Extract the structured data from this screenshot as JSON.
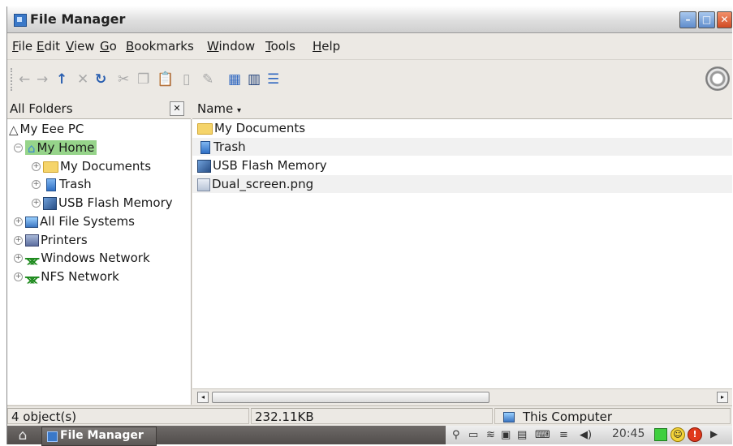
{
  "window": {
    "title": "File Manager"
  },
  "menu": [
    "File",
    "Edit",
    "View",
    "Go",
    "Bookmarks",
    "Window",
    "Tools",
    "Help"
  ],
  "folders_pane": {
    "header": "All Folders",
    "tree": [
      {
        "label": "My Eee PC"
      },
      {
        "label": "My Home"
      },
      {
        "label": "My Documents"
      },
      {
        "label": "Trash"
      },
      {
        "label": "USB Flash Memory"
      },
      {
        "label": "All File Systems"
      },
      {
        "label": "Printers"
      },
      {
        "label": "Windows Network"
      },
      {
        "label": "NFS Network"
      }
    ]
  },
  "file_list": {
    "column": "Name",
    "rows": [
      {
        "name": "My Documents"
      },
      {
        "name": "Trash"
      },
      {
        "name": "USB Flash Memory"
      },
      {
        "name": "Dual_screen.png"
      }
    ]
  },
  "status": {
    "count": "4 object(s)",
    "size": "232.11KB",
    "location": "This Computer"
  },
  "taskbar": {
    "task_label": "File Manager",
    "clock": "20:45"
  }
}
